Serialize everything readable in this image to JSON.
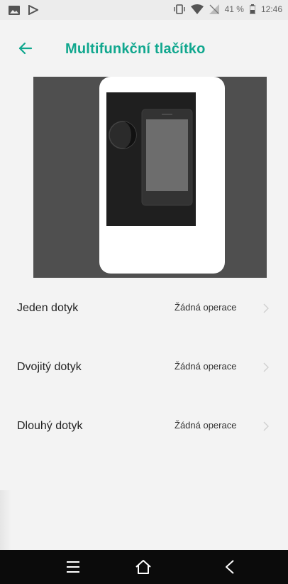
{
  "status_bar": {
    "battery": "41 %",
    "time": "12:46",
    "icons": [
      "image-icon",
      "play-store-icon",
      "vibrate-icon",
      "wifi-icon",
      "no-signal-icon",
      "battery-icon"
    ]
  },
  "app_bar": {
    "title": "Multifunkční tlačítko",
    "back_icon": "arrow-left-icon"
  },
  "settings": {
    "items": [
      {
        "label": "Jeden dotyk",
        "value": "Žádná operace"
      },
      {
        "label": "Dvojitý dotyk",
        "value": "Žádná operace"
      },
      {
        "label": "Dlouhý dotyk",
        "value": "Žádná operace"
      }
    ]
  },
  "nav_bar": {
    "buttons": [
      "menu-icon",
      "home-icon",
      "back-icon"
    ]
  },
  "colors": {
    "accent": "#10a78e",
    "illustration_bg": "#4f4f4f",
    "nav_bg": "#0b0b0b",
    "background": "#f3f3f3"
  }
}
